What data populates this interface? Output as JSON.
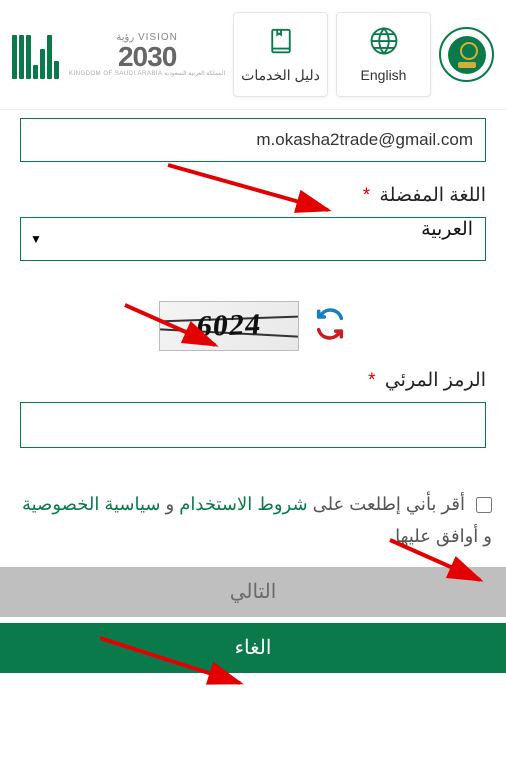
{
  "header": {
    "english_label": "English",
    "services_label": "دليل الخدمات",
    "vision_top": "VISION رؤية",
    "vision_num": "2030",
    "vision_sub": "المملكة العربية السعودية KINGDOM OF SAUDI ARABIA"
  },
  "form": {
    "email_value": "m.okasha2trade@gmail.com",
    "lang_label": "اللغة المفضلة",
    "lang_selected": "العربية",
    "captcha_value": "6024",
    "captcha_label": "الرمز المرئي",
    "captcha_input_value": ""
  },
  "consent": {
    "prefix": "أقر بأني إطلعت على ",
    "terms": "شروط الاستخدام",
    "and1": " و ",
    "privacy": "سياسية الخصوصية",
    "suffix": " و أوافق عليها"
  },
  "buttons": {
    "next": "التالي",
    "cancel": "الغاء"
  }
}
